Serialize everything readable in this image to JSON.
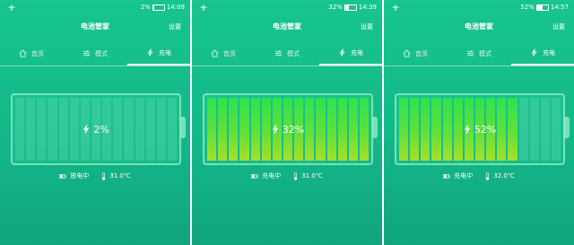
{
  "screens": [
    {
      "status": {
        "battery_text": "2%",
        "time": "14:09",
        "battery_fill": 0.02
      },
      "header": {
        "title": "电池管家",
        "settings_label": "设置"
      },
      "tabs": [
        {
          "label": "首页",
          "icon": "home-icon",
          "active": false
        },
        {
          "label": "模式",
          "icon": "sliders-icon",
          "active": false
        },
        {
          "label": "充电",
          "icon": "charge-bolt-icon",
          "active": true
        }
      ],
      "battery": {
        "percent_label": "2%",
        "level": 0.02,
        "segments_total": 15,
        "segments_lit": 0
      },
      "info": {
        "status_label": "放电中",
        "temperature": "31.0℃"
      }
    },
    {
      "status": {
        "battery_text": "32%",
        "time": "14:39",
        "battery_fill": 0.32
      },
      "header": {
        "title": "电池管家",
        "settings_label": "设置"
      },
      "tabs": [
        {
          "label": "首页",
          "icon": "home-icon",
          "active": false
        },
        {
          "label": "模式",
          "icon": "sliders-icon",
          "active": false
        },
        {
          "label": "充电",
          "icon": "charge-bolt-icon",
          "active": true
        }
      ],
      "battery": {
        "percent_label": "32%",
        "level": 0.32,
        "segments_total": 15,
        "segments_lit": 15
      },
      "info": {
        "status_label": "充电中",
        "temperature": "31.0℃"
      }
    },
    {
      "status": {
        "battery_text": "52%",
        "time": "14:57",
        "battery_fill": 0.52
      },
      "header": {
        "title": "电池管家",
        "settings_label": "设置"
      },
      "tabs": [
        {
          "label": "首页",
          "icon": "home-icon",
          "active": false
        },
        {
          "label": "模式",
          "icon": "sliders-icon",
          "active": false
        },
        {
          "label": "充电",
          "icon": "charge-bolt-icon",
          "active": true
        }
      ],
      "battery": {
        "percent_label": "52%",
        "level": 0.52,
        "segments_total": 15,
        "segments_lit": 11
      },
      "info": {
        "status_label": "充电中",
        "temperature": "32.0℃"
      }
    }
  ],
  "colors": {
    "background": "#17c58d",
    "segment_lit": "#62e03a",
    "segment_empty": "#7ae1b9",
    "text": "#ffffff"
  }
}
